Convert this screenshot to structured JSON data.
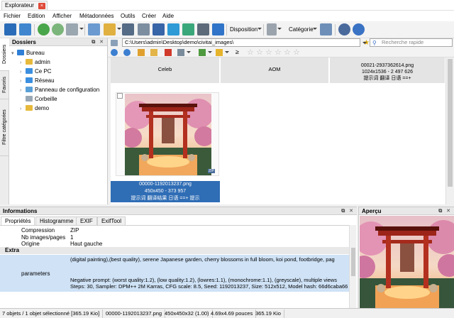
{
  "window": {
    "tab_title": "Explorateur",
    "tab_close": "×"
  },
  "menu": [
    "Fichier",
    "Edition",
    "Afficher",
    "Métadonnées",
    "Outils",
    "Créer",
    "Aide"
  ],
  "toolbar": {
    "disposition_label": "Disposition",
    "categorie_label": "Catégorie"
  },
  "side_tabs": [
    "Dossiers",
    "Favoris",
    "Filtre catégories"
  ],
  "dossiers": {
    "title": "Dossiers",
    "panel_buttons": "⧉ ✕",
    "tree": [
      {
        "label": "Bureau",
        "level": 0,
        "expanded": true,
        "icon_color": "#2f7fd6"
      },
      {
        "label": "admin",
        "level": 1,
        "expanded": false,
        "icon_color": "#e7b93c"
      },
      {
        "label": "Ce PC",
        "level": 1,
        "expanded": false,
        "icon_color": "#3b8fe0"
      },
      {
        "label": "Réseau",
        "level": 1,
        "expanded": false,
        "icon_color": "#3b8fe0"
      },
      {
        "label": "Panneau de configuration",
        "level": 1,
        "expanded": false,
        "icon_color": "#5aa0d8"
      },
      {
        "label": "Corbeille",
        "level": 1,
        "expanded": null,
        "icon_color": "#9aa8b5"
      },
      {
        "label": "demo",
        "level": 1,
        "expanded": false,
        "icon_color": "#e7b93c"
      }
    ]
  },
  "path": {
    "value": "C:\\Users\\admin\\Desktop\\demo\\civitai_images\\",
    "search_placeholder": "Recherche rapide"
  },
  "filter": {
    "compare_op": "≥",
    "stars": [
      "☆",
      "☆",
      "☆",
      "☆",
      "☆",
      "☆"
    ]
  },
  "gallery": {
    "groups": [
      {
        "title": "Celeb",
        "lines": []
      },
      {
        "title": "AOM",
        "lines": []
      },
      {
        "title": "",
        "lines": [
          "00021-2937362614.png",
          "1024x1536 - 2 497 626",
          "提示词 翻译 日语 ==+"
        ]
      }
    ],
    "thumbnail": {
      "badge": "ZIP",
      "caption": [
        "00000-1192013237.png",
        "450x450 - 373 957",
        "提示词 翻译结果 日语 ==+ 提示"
      ]
    }
  },
  "info": {
    "title": "Informations",
    "panel_buttons": "⧉ ✕",
    "tabs": [
      "Propriétés",
      "Histogramme",
      "EXIF",
      "ExifTool"
    ],
    "props": [
      {
        "key": "Compression",
        "value": "ZIP"
      },
      {
        "key": "Nb images/pages",
        "value": "1"
      },
      {
        "key": "Origine",
        "value": "Haut gauche"
      }
    ],
    "section": "Extra",
    "param_key": "parameters",
    "param_lines": [
      "(digital painting),(best quality), serene Japanese garden, cherry blossoms in full bloom, koi pond, footbridge, pag",
      "",
      "Negative prompt: (worst quality:1.2), (low quality:1.2), (lowres:1.1), (monochrome:1.1), (greyscale), multiple views",
      "Steps: 30, Sampler: DPM++ 2M Karras, CFG scale: 8.5, Seed: 1192013237, Size: 512x512, Model hash: 66d6caba66, M"
    ]
  },
  "apercu": {
    "title": "Aperçu",
    "panel_buttons": "⧉ ✕"
  },
  "status": [
    "7 objets / 1 objet sélectionné [365.19 Kio]",
    "00000-1192013237.png",
    "450x450x32 (1.00)",
    "4.69x4.69 pouces",
    "365.19 Kio"
  ]
}
